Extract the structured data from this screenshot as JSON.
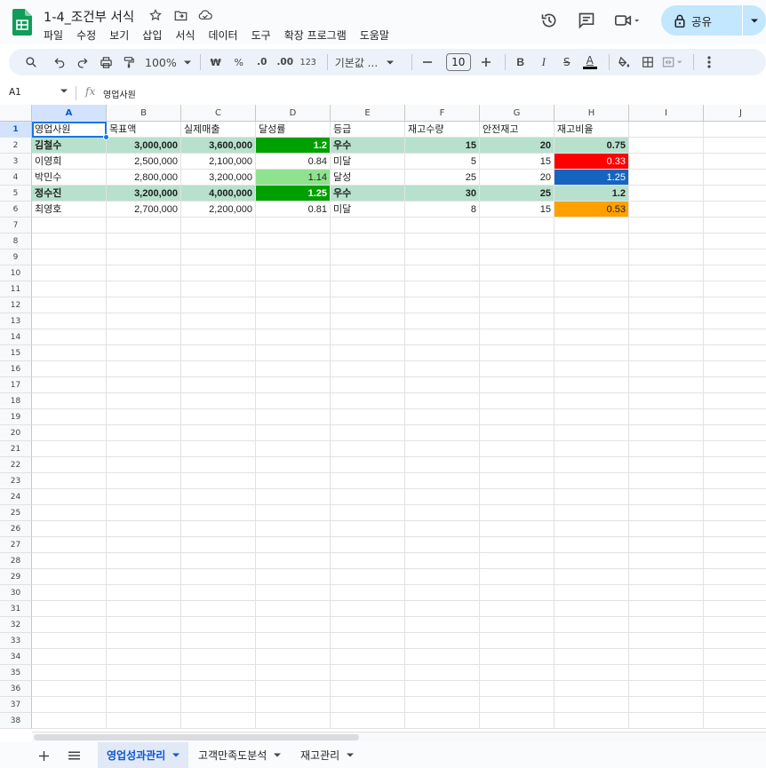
{
  "app": {
    "title": "1-4_조건부 서식",
    "menu": [
      "파일",
      "수정",
      "보기",
      "삽입",
      "서식",
      "데이터",
      "도구",
      "확장 프로그램",
      "도움말"
    ],
    "share_label": "공유"
  },
  "toolbar": {
    "zoom": "100%",
    "currency": "₩",
    "percent": "%",
    "decrease_decimal": ".0",
    "increase_decimal": ".00",
    "number_format": "123",
    "font": "기본값 ...",
    "font_size": "10"
  },
  "formula_bar": {
    "cell_ref": "A1",
    "fx": "fx",
    "value": "영업사원"
  },
  "columns": [
    "A",
    "B",
    "C",
    "D",
    "E",
    "F",
    "G",
    "H",
    "I",
    "J"
  ],
  "rows": [
    "1",
    "2",
    "3",
    "4",
    "5",
    "6",
    "7",
    "8",
    "9",
    "10",
    "11",
    "12",
    "13",
    "14",
    "15",
    "16",
    "17",
    "18",
    "19",
    "20",
    "21",
    "22",
    "23",
    "24",
    "25",
    "26",
    "27",
    "28",
    "29",
    "30",
    "31",
    "32",
    "33",
    "34",
    "35",
    "36",
    "37",
    "38"
  ],
  "table": {
    "headers": [
      "영업사원",
      "목표액",
      "실제매출",
      "달성률",
      "등급",
      "재고수량",
      "안전재고",
      "재고비율"
    ],
    "records": [
      [
        "김철수",
        "3,000,000",
        "3,600,000",
        "1.2",
        "우수",
        "15",
        "20",
        "0.75"
      ],
      [
        "이영희",
        "2,500,000",
        "2,100,000",
        "0.84",
        "미달",
        "5",
        "15",
        "0.33"
      ],
      [
        "박민수",
        "2,800,000",
        "3,200,000",
        "1.14",
        "달성",
        "25",
        "20",
        "1.25"
      ],
      [
        "정수진",
        "3,200,000",
        "4,000,000",
        "1.25",
        "우수",
        "30",
        "25",
        "1.2"
      ],
      [
        "최영호",
        "2,700,000",
        "2,200,000",
        "0.81",
        "미달",
        "8",
        "15",
        "0.53"
      ]
    ]
  },
  "colors": {
    "row_highlight": "#b7e1cd",
    "green_strong": "#00a000",
    "green_light": "#8fe38f",
    "red": "#ff0000",
    "blue": "#1565c0",
    "orange": "#ffa000",
    "accent": "#0b57d0"
  },
  "sheets": [
    {
      "name": "영업성과관리",
      "active": true
    },
    {
      "name": "고객만족도분석",
      "active": false
    },
    {
      "name": "재고관리",
      "active": false
    }
  ]
}
